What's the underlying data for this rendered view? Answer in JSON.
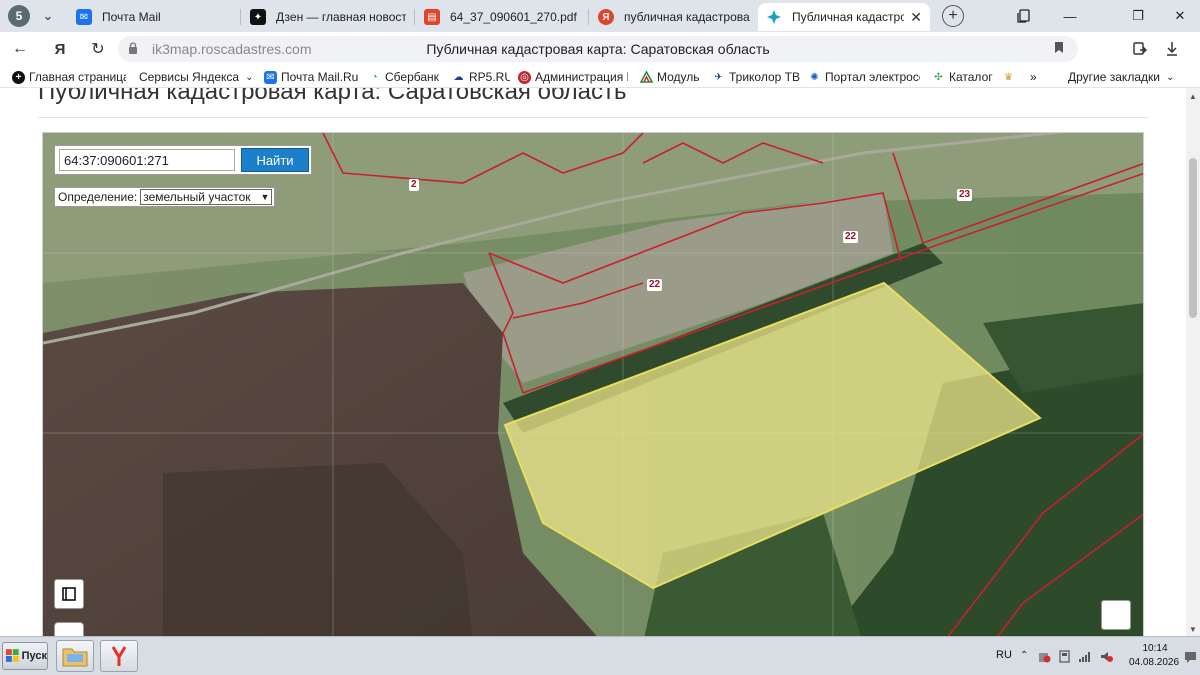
{
  "browser": {
    "profile_letter": "5",
    "tabs": [
      {
        "title": "Почта Mail",
        "fav_color": "#1a73e8",
        "fav_glyph": "✉"
      },
      {
        "title": "Дзен — главная новостн",
        "fav_color": "#111111",
        "fav_glyph": "✦"
      },
      {
        "title": "64_37_090601_270.pdf",
        "fav_color": "#e0452c",
        "fav_glyph": "▤"
      },
      {
        "title": "публичная кадастровая к",
        "fav_color": "#e0452c",
        "fav_glyph": "Я"
      },
      {
        "title": "Публичная кадастрова",
        "fav_color": "#ffffff",
        "fav_glyph": "✦",
        "active": true
      }
    ],
    "url": "ik3map.roscadastres.com",
    "page_title": "Публичная кадастровая карта: Саратовская область",
    "bookmarks": [
      {
        "label": "Главная страница",
        "icon": "plus-icon"
      },
      {
        "label": "Сервисы Яндекса",
        "icon": "chevron-down-icon"
      },
      {
        "label": "Почта Mail.Ru",
        "icon": "mail-icon"
      },
      {
        "label": "Сбербанк",
        "icon": "sber-icon"
      },
      {
        "label": "RP5.RU",
        "icon": "rp5-icon"
      },
      {
        "label": "Администрация Ц",
        "icon": "admin-icon"
      },
      {
        "label": "Модуль",
        "icon": "modul-icon"
      },
      {
        "label": "Триколор ТВ",
        "icon": "tricolor-icon"
      },
      {
        "label": "Портал электросе",
        "icon": "portal-icon"
      },
      {
        "label": "Каталог",
        "icon": "catalog-icon"
      },
      {
        "label": "",
        "icon": "emblem-icon"
      },
      {
        "label": "»",
        "icon": "more-icon"
      }
    ],
    "other_bookmarks": "Другие закладки"
  },
  "page": {
    "heading": "Публичная кадастровая карта: Саратовская область",
    "search": {
      "value": "64:37:090601:271",
      "button": "Найти"
    },
    "definition": {
      "label": "Определение:",
      "selected": "земельный участок"
    },
    "plot_labels": [
      "2",
      "22",
      "22",
      "23"
    ],
    "colors": {
      "boundary": "#c8202c",
      "highlight": "#f2ea8a",
      "search_button": "#1b7fc9"
    }
  },
  "taskbar": {
    "start": "Пуск",
    "lang": "RU",
    "time": "10:14",
    "date": "04.08.2026"
  }
}
